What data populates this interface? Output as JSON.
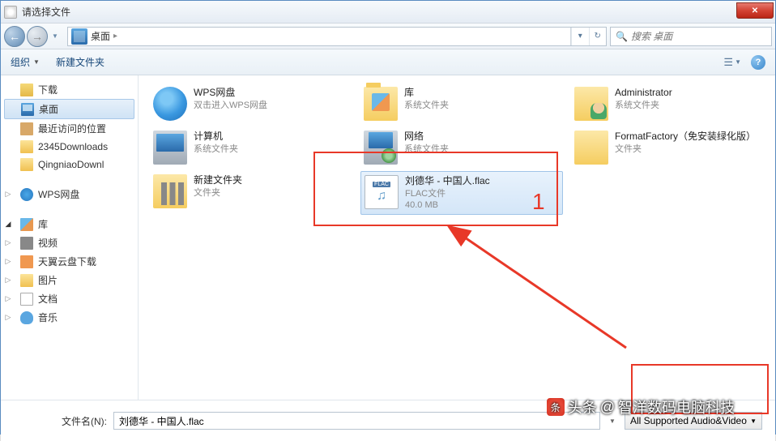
{
  "title": "请选择文件",
  "nav": {
    "location": "桌面"
  },
  "search": {
    "placeholder": "搜索 桌面"
  },
  "toolbar": {
    "organize": "组织",
    "newfolder": "新建文件夹"
  },
  "sidebar": {
    "downloads": "下载",
    "desktop": "桌面",
    "recent": "最近访问的位置",
    "dl2345": "2345Downloads",
    "qingniao": "QingniaoDownl",
    "wps": "WPS网盘",
    "lib": "库",
    "video": "视频",
    "tianyi": "天翼云盘下载",
    "pictures": "图片",
    "docs": "文档",
    "music": "音乐"
  },
  "files": {
    "wps": {
      "name": "WPS网盘",
      "sub": "双击进入WPS网盘"
    },
    "lib": {
      "name": "库",
      "sub": "系统文件夹"
    },
    "admin": {
      "name": "Administrator",
      "sub": "系统文件夹"
    },
    "computer": {
      "name": "计算机",
      "sub": "系统文件夹"
    },
    "network": {
      "name": "网络",
      "sub": "系统文件夹"
    },
    "ff": {
      "name": "FormatFactory（免安装绿化版）",
      "sub": "文件夹"
    },
    "newfolder": {
      "name": "新建文件夹",
      "sub": "文件夹"
    },
    "flac": {
      "name": "刘德华 - 中国人.flac",
      "type": "FLAC文件",
      "size": "40.0 MB",
      "badge": "FLAC"
    }
  },
  "bottom": {
    "label": "文件名(N):",
    "value": "刘德华 - 中国人.flac",
    "filter": "All Supported Audio&Video"
  },
  "annotations": {
    "num1": "1"
  },
  "watermark": {
    "prefix": "头条",
    "at": "@",
    "text": "智洋数码电脑科技"
  }
}
